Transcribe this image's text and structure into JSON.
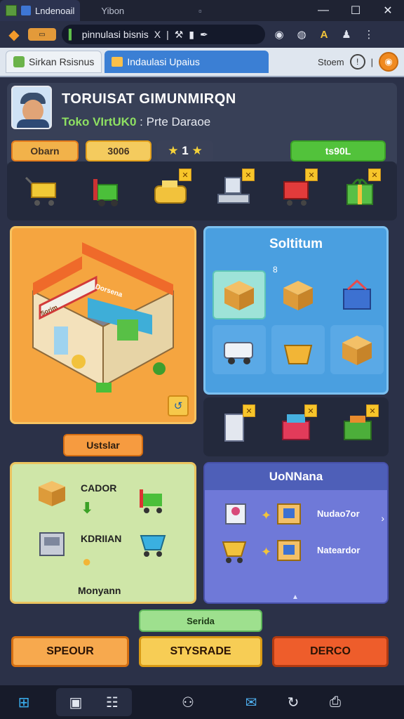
{
  "window": {
    "tabs": [
      {
        "label": "Lndenoail",
        "active": true
      },
      {
        "label": "Yibon",
        "active": false
      }
    ]
  },
  "browser": {
    "tab_label": "pinnulasi bisnis",
    "close": "X"
  },
  "apptabs": {
    "tab1": "Sirkan Rsisnus",
    "tab2": "Indaulasi Upaius",
    "right_label": "Stoem"
  },
  "profile": {
    "title": "TORUISAT GIMUNMIRQN",
    "subtitle_green": "Toko VIrtUK0",
    "subtitle_white": "Prte Daraoe",
    "pill1": "Obarn",
    "pill2": "3006",
    "pill3": "1",
    "pill4": "ts90L"
  },
  "shop": {
    "sign": "Dorsena",
    "side_sign": "Sorim",
    "button": "Ustslar"
  },
  "solution": {
    "title": "Soltitum",
    "marker": "8"
  },
  "green_panel": {
    "label1": "CADOR",
    "label2": "KDRIIAN",
    "footer": "Monyann"
  },
  "blue_panel": {
    "title": "UoNNana",
    "row1": "Nudao7or",
    "row2": "Nateardor"
  },
  "actions": {
    "small": "Serida",
    "b1": "SPEOUR",
    "b2": "STYSRADE",
    "b3": "DERCO"
  },
  "colors": {
    "accent_blue": "#3b7fd4",
    "shop_orange": "#f5a540",
    "solution_blue": "#4a9fe0",
    "green_panel": "#cfe6a8",
    "blue_panel": "#6f79d8",
    "danger": "#ee5d2b"
  },
  "icons": [
    "cart-gold",
    "forklift",
    "cash-register",
    "pos-terminal",
    "red-cart",
    "gift-box"
  ]
}
